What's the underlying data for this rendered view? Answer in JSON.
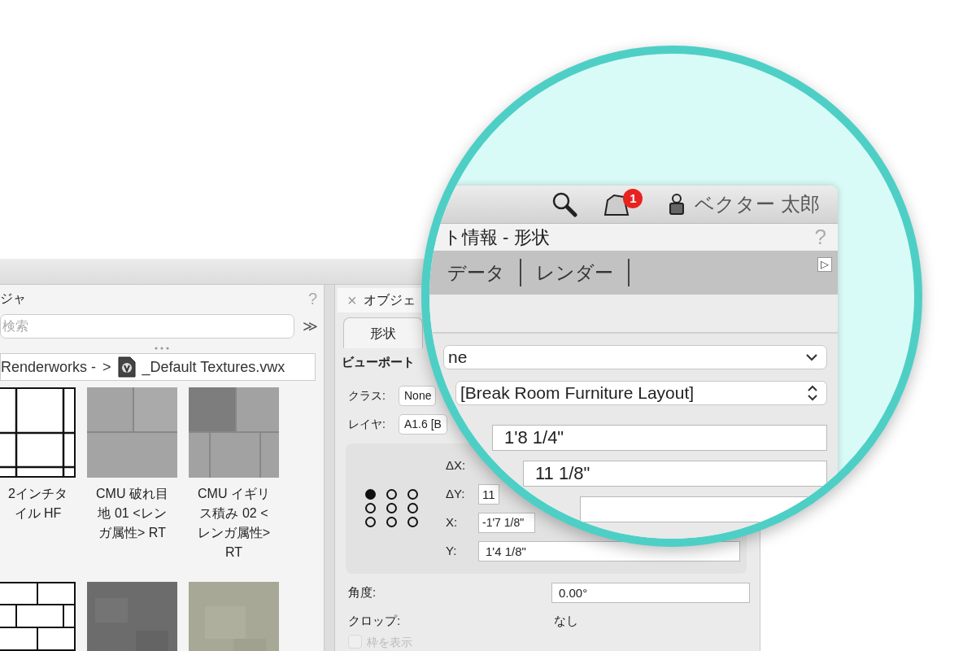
{
  "left_panel": {
    "title": "ジャ",
    "help": "?",
    "search": {
      "placeholder": "検索"
    },
    "more": "≫",
    "breadcrumb": {
      "path": "Renderworks - ",
      "separator": ">",
      "file": "_Default Textures.vwx"
    },
    "thumbnails": [
      {
        "kind": "grid-tile",
        "label": "2インチタイル HF"
      },
      {
        "kind": "cmu",
        "label": "CMU  破れ目地 01 <レンガ属性> RT"
      },
      {
        "kind": "cmu-dark",
        "label": "CMU イギリス積み 02 <レンガ属性> RT"
      },
      {
        "kind": "brick-lines"
      },
      {
        "kind": "concrete"
      },
      {
        "kind": "stucco"
      }
    ]
  },
  "object_info": {
    "close": "×",
    "title": "オブジェ",
    "tabs": [
      {
        "label": "形状",
        "selected": true
      }
    ],
    "section": "ビューポート",
    "fields": [
      {
        "label": "クラス:",
        "value": "None"
      },
      {
        "label": "レイヤ:",
        "value": "A1.6 [B"
      }
    ],
    "anchors": [
      {
        "selected": true
      },
      {
        "selected": false
      },
      {
        "selected": false
      },
      {
        "selected": false
      },
      {
        "selected": false
      },
      {
        "selected": false
      },
      {
        "selected": false
      },
      {
        "selected": false
      },
      {
        "selected": false
      }
    ],
    "coords": [
      {
        "label": "ΔX:"
      },
      {
        "label": "ΔY:",
        "value": "11"
      },
      {
        "label": "X:",
        "value": "-1'7 1/8\""
      },
      {
        "label": "Y:",
        "value": "1'4 1/8\""
      }
    ],
    "angle": {
      "label": "角度:",
      "value": "0.00°"
    },
    "crop": {
      "label": "クロップ:",
      "value": "なし"
    },
    "show_frame": {
      "label": "枠を表示",
      "checked": false,
      "disabled": true
    }
  },
  "magnifier": {
    "notifications": "1",
    "user": "ベクター 太郎",
    "title": "ト情報 - 形状",
    "help": "?",
    "tabs": [
      {
        "label": "データ"
      },
      {
        "label": "レンダー"
      }
    ],
    "expand": "▷",
    "dropdowns": [
      {
        "kind": "select",
        "value": "ne"
      },
      {
        "kind": "stepper",
        "value": "[Break Room Furniture Layout]"
      }
    ],
    "fields": [
      {
        "value": "1'8 1/4\""
      },
      {
        "value": "11 1/8\""
      }
    ]
  }
}
